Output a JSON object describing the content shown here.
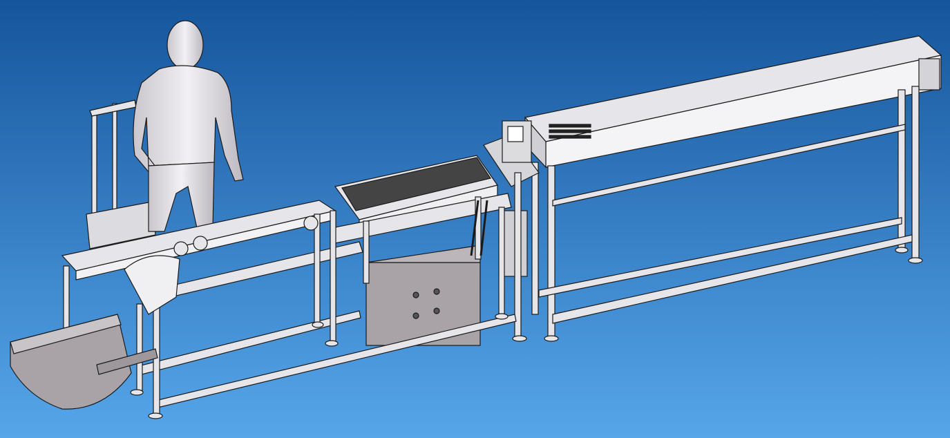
{
  "colors": {
    "background_top": "#15559c",
    "background_bottom": "#57a6ea",
    "frame": "#e6e6ea",
    "cabinet": "#a9a3a8",
    "outline": "#1a1a1a"
  }
}
